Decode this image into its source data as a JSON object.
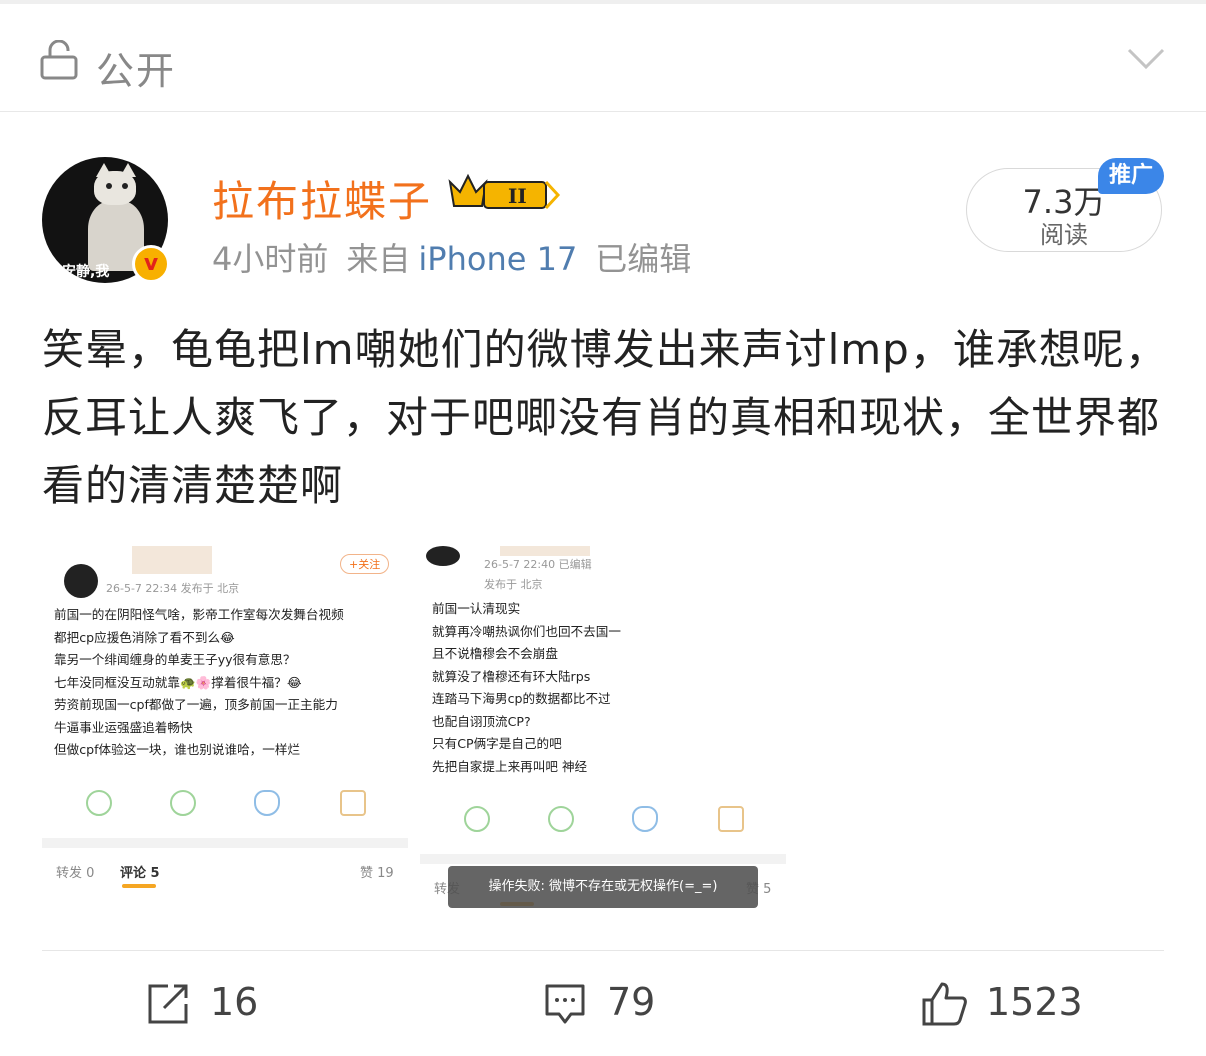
{
  "privacy": {
    "label": "公开"
  },
  "post": {
    "author": "拉布拉蝶子",
    "level_badge": "II",
    "avatar_caption": "安静,我",
    "verified_mark": "v",
    "time": "4小时前",
    "source_prefix": "来自",
    "source": "iPhone 17",
    "edited": "已编辑",
    "reads_count": "7.3万",
    "reads_label": "阅读",
    "promo": "推广",
    "text": "笑晕，龟龟把lm嘲她们的微博发出来声讨lmp，谁承想呢，反耳让人爽飞了，对于吧唧没有肖的真相和现状，全世界都看的清清楚楚啊"
  },
  "image1": {
    "follow": "+关注",
    "date": "26-5-7 22:34  发布于 北京",
    "lines": [
      "前国一的在阴阳怪气啥，影帝工作室每次发舞台视频",
      "都把cp应援色消除了看不到么😂",
      "靠另一个绯闻缠身的单麦王子yy很有意思？",
      "七年没同框没互动就靠🐢🌸撑着很牛福？😂",
      "劳资前现国一cpf都做了一遍，顶多前国一正主能力",
      "牛逼事业运强盛追着畅快",
      "但做cpf体验这一块，谁也别说谁哈，一样烂"
    ],
    "tab_repost": "转发 0",
    "tab_comment": "评论 5",
    "tab_like": "赞 19"
  },
  "image2": {
    "date": "26-5-7 22:40  已编辑",
    "location": "发布于 北京",
    "lines": [
      "前国一认清现实",
      "就算再冷嘲热讽你们也回不去国一",
      "且不说橹穆会不会崩盘",
      "就算没了橹穆还有环大陆rps",
      "连踏马下海男cp的数据都比不过",
      "也配自诩顶流CP?",
      "只有CP俩字是自己的吧",
      "先把自家提上来再叫吧  神经"
    ],
    "tab_repost": "转发",
    "tab_like": "赞 5",
    "toast": "操作失败: 微博不存在或无权操作(=_=)"
  },
  "actions": {
    "reposts": "16",
    "comments": "79",
    "likes": "1523"
  },
  "colors": {
    "username": "#f2711c",
    "source_link": "#507daf",
    "promo_bg": "#3b86e8"
  }
}
